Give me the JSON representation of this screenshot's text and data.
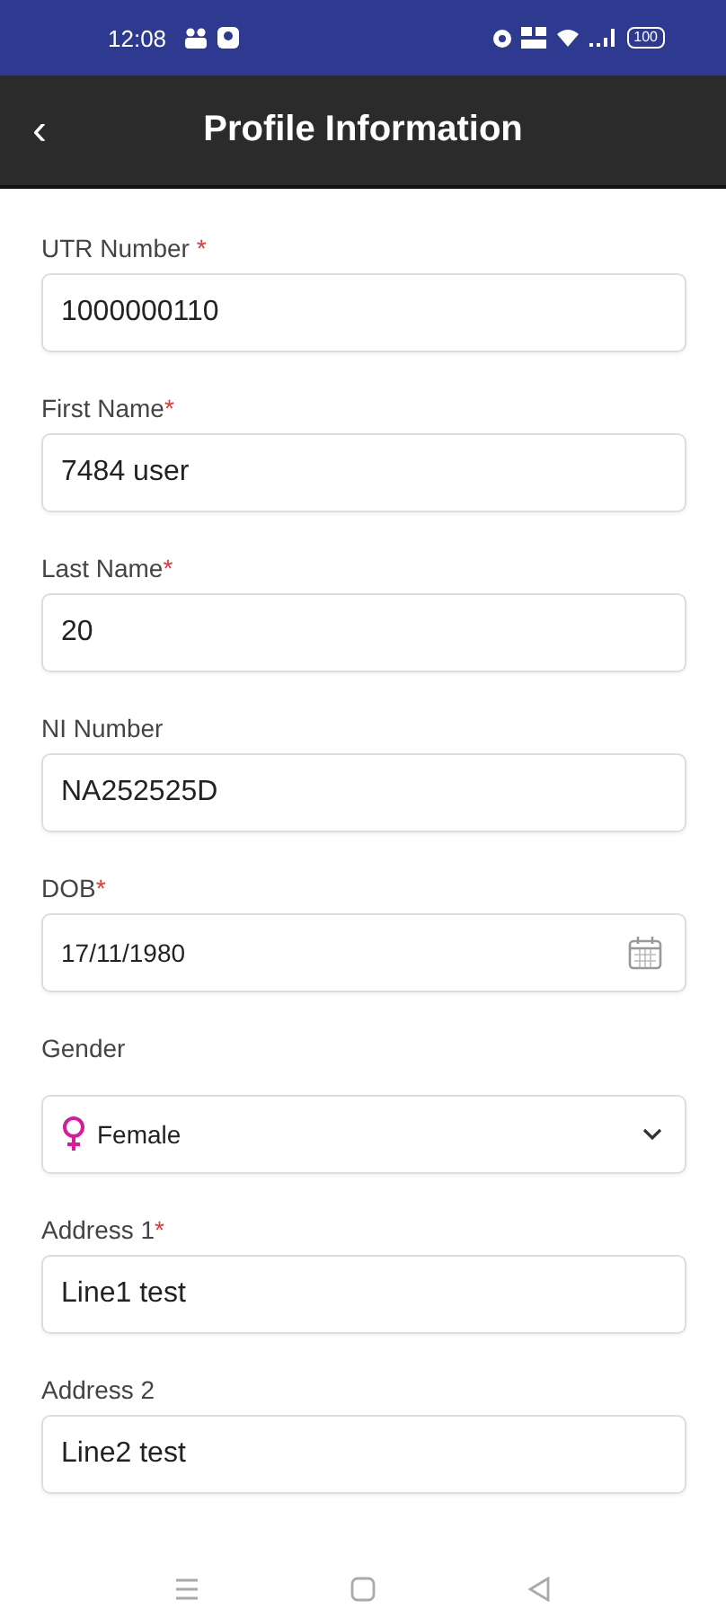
{
  "status_bar": {
    "time": "12:08",
    "battery": "100"
  },
  "header": {
    "back": "‹",
    "title": "Profile Information"
  },
  "fields": [
    {
      "kind": "text",
      "label": "UTR Number ",
      "required_mark": "*",
      "value": "1000000110"
    },
    {
      "kind": "text",
      "label": "First Name",
      "required_mark": "*",
      "value": "7484 user"
    },
    {
      "kind": "text",
      "label": "Last Name",
      "required_mark": "*",
      "value": "20"
    },
    {
      "kind": "text",
      "label": "NI Number",
      "value": "NA252525D"
    },
    {
      "kind": "date",
      "label": "DOB",
      "required_mark": "*",
      "value": "17/11/1980"
    },
    {
      "kind": "select",
      "label": "Gender",
      "value": "Female"
    },
    {
      "kind": "text",
      "label": "Address 1",
      "required_mark": "*",
      "value": "Line1 test"
    },
    {
      "kind": "text",
      "label": "Address 2",
      "value": "Line2 test"
    }
  ]
}
